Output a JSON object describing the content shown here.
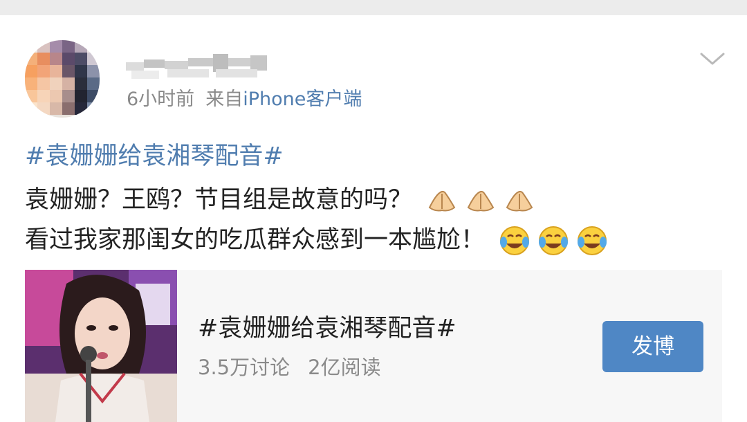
{
  "post": {
    "username": "",
    "meta": {
      "time": "6小时前",
      "source_prefix": "来自",
      "client": "iPhone客户端"
    },
    "topic": "#袁姗姗给袁湘琴配音#",
    "lines": [
      "袁姗姗？王鸥？节目组是故意的吗？",
      "看过我家那闺女的吃瓜群众感到一本尴尬！"
    ],
    "line_emojis": [
      [
        "folded-hands-emoji",
        "folded-hands-emoji",
        "folded-hands-emoji"
      ],
      [
        "crying-laughing-emoji",
        "crying-laughing-emoji",
        "crying-laughing-emoji"
      ]
    ]
  },
  "topic_card": {
    "title": "#袁姗姗给袁湘琴配音#",
    "discussions": "3.5万讨论",
    "reads": "2亿阅读",
    "button_label": "发博"
  },
  "colors": {
    "link": "#507daf",
    "button": "#4f87c5",
    "card_bg": "#f7f7f7",
    "meta": "#8a8a8a",
    "text": "#222222"
  }
}
